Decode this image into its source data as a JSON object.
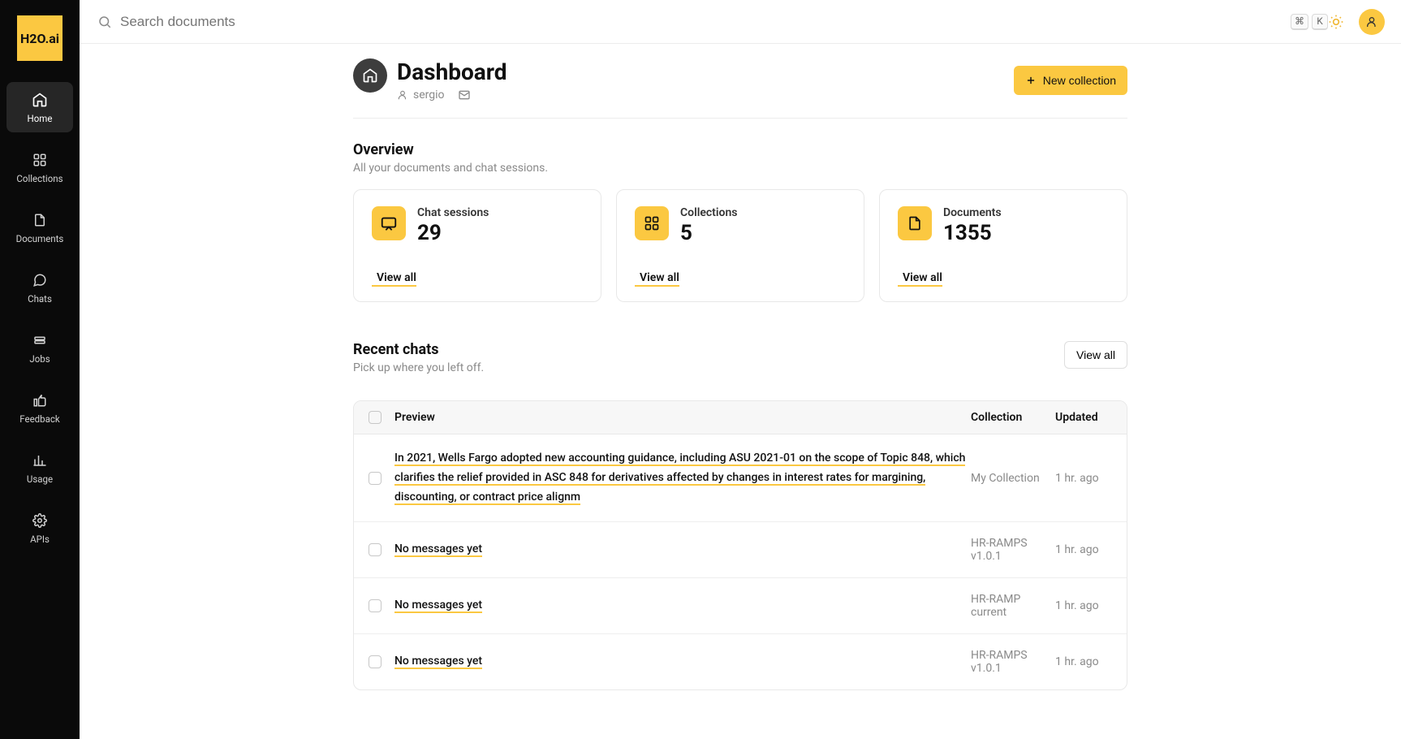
{
  "brand": "H2O.ai",
  "sidebar": {
    "items": [
      {
        "label": "Home"
      },
      {
        "label": "Collections"
      },
      {
        "label": "Documents"
      },
      {
        "label": "Chats"
      },
      {
        "label": "Jobs"
      },
      {
        "label": "Feedback"
      },
      {
        "label": "Usage"
      },
      {
        "label": "APIs"
      }
    ]
  },
  "search": {
    "placeholder": "Search documents",
    "kbd1": "⌘",
    "kbd2": "K"
  },
  "page": {
    "title": "Dashboard",
    "user": "sergio",
    "new_collection_label": "New collection"
  },
  "overview": {
    "heading": "Overview",
    "subheading": "All your documents and chat sessions.",
    "cards": [
      {
        "label": "Chat sessions",
        "value": "29",
        "link": "View all"
      },
      {
        "label": "Collections",
        "value": "5",
        "link": "View all"
      },
      {
        "label": "Documents",
        "value": "1355",
        "link": "View all"
      }
    ]
  },
  "recent": {
    "heading": "Recent chats",
    "subheading": "Pick up where you left off.",
    "view_all": "View all",
    "columns": {
      "preview": "Preview",
      "collection": "Collection",
      "updated": "Updated"
    },
    "rows": [
      {
        "preview": "In 2021, Wells Fargo adopted new accounting guidance, including ASU 2021-01 on the scope of Topic 848, which clarifies the relief provided in ASC 848 for derivatives affected by changes in interest rates for margining, discounting, or contract price alignm",
        "collection": "My Collection",
        "updated": "1 hr. ago"
      },
      {
        "preview": "No messages yet",
        "collection": "HR-RAMPS v1.0.1",
        "updated": "1 hr. ago"
      },
      {
        "preview": "No messages yet",
        "collection": "HR-RAMP current",
        "updated": "1 hr. ago"
      },
      {
        "preview": "No messages yet",
        "collection": "HR-RAMPS v1.0.1",
        "updated": "1 hr. ago"
      }
    ]
  }
}
